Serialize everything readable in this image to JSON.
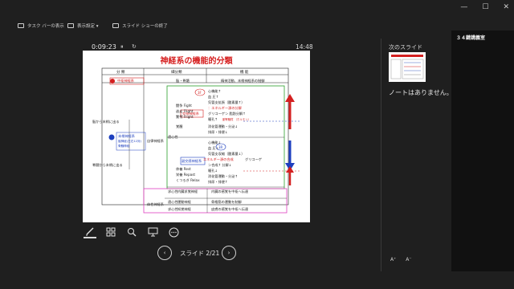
{
  "window": {
    "minimize": "—",
    "maximize": "☐",
    "close": "✕"
  },
  "toolbar_top": {
    "taskbar_label": "タスク バーの表示",
    "display_settings_label": "表示設定 ▾",
    "end_show_label": "スライド ショーの終了"
  },
  "presenter": {
    "timer": "0:09:23",
    "pause": "⏸",
    "reset": "↻",
    "clock": "14:48"
  },
  "slide": {
    "title": "神経系の機能的分類",
    "headers": [
      "分 類",
      "細分類",
      "機 能"
    ],
    "cns_label": "中枢神経系",
    "brain_spinal": "脳・脊髄",
    "cns_func": "精神活動、末梢神経系の制御",
    "pns_label": "末梢神経系",
    "pns_sub1": "脳神経(左右12対)",
    "pns_sub2": "脊髄神経",
    "from_brain": "脳から末梢に出る",
    "from_spine": "脊髄から末梢に出る",
    "autonomic": "自律神経系",
    "somatic": "体性神経系",
    "efferent": "遠心性",
    "afferent": "求心性",
    "sympathetic": "交感神経系",
    "parasympathetic": "副交感神経系",
    "symp_state1": "闘争 Fight",
    "symp_state2": "逃走 Flight",
    "symp_state3": "驚愕 Fright",
    "symp_state4": "覚醒",
    "para_state1": "休養 Rest",
    "para_state2": "栄養 Repast",
    "para_state3": "くつろぎ Relax",
    "symp_effects": [
      "心機能↑",
      "血 圧↑",
      "気管支拡張（酸素量↑）",
      "：エネルギー源の分解",
      "グリコーゲン 脂肪分解↑",
      "瞳孔↑",
      "副腎髄質 （ホルモン）",
      "消化管運動・分泌↓",
      "排尿・排便↓"
    ],
    "para_effects": [
      "心機能↓",
      "血 圧↓",
      "気管支収縮（酸素量↓）",
      "エネルギー源の合成",
      "グリコーゲ",
      "ン合成↑ 分解↓",
      "瞳孔↓",
      "消化管運動・分泌↑",
      "排尿・排便↑"
    ],
    "sym_badge": "3F",
    "para_badge": "3R",
    "motor": "運動神経",
    "sensory": "知覚神経",
    "internal_sensory": "内臓求覚神経",
    "internal_sensory_func": "内臓の感覚を中枢へ伝達",
    "motor_func": "骨格筋の運動を制御",
    "sensory_func": "皮膚の感覚を中枢へ伝達"
  },
  "bottom_toolbar": {
    "pen": "pen-icon",
    "grid": "grid-icon",
    "zoom": "zoom-icon",
    "screen": "screen-icon",
    "more": "⋯"
  },
  "navigation": {
    "prev": "‹",
    "next": "›",
    "slide_counter": "スライド 2/21"
  },
  "side": {
    "next_slide_label": "次のスライド",
    "notes_text": "ノートはありません。",
    "font_increase": "A⁺",
    "font_decrease": "A⁻"
  },
  "right_panel": {
    "label": "３４鍵講義室"
  }
}
